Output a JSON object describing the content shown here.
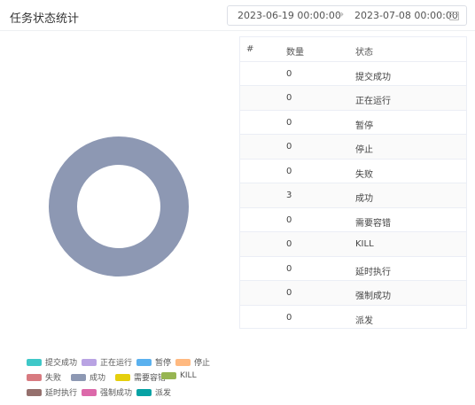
{
  "header": {
    "title": "任务状态统计",
    "date_start": "2023-06-19 00:00:00",
    "date_separator": "→",
    "date_end": "2023-07-08 00:00:00"
  },
  "table": {
    "columns": [
      "#",
      "数量",
      "状态"
    ],
    "rows": [
      {
        "count": "0",
        "status": "提交成功"
      },
      {
        "count": "0",
        "status": "正在运行"
      },
      {
        "count": "0",
        "status": "暂停"
      },
      {
        "count": "0",
        "status": "停止"
      },
      {
        "count": "0",
        "status": "失败"
      },
      {
        "count": "3",
        "status": "成功"
      },
      {
        "count": "0",
        "status": "需要容错"
      },
      {
        "count": "0",
        "status": "KILL"
      },
      {
        "count": "0",
        "status": "延时执行"
      },
      {
        "count": "0",
        "status": "强制成功"
      },
      {
        "count": "0",
        "status": "派发"
      }
    ]
  },
  "legend": [
    {
      "label": "提交成功",
      "color": "#3fc8c8"
    },
    {
      "label": "正在运行",
      "color": "#b9a3e3"
    },
    {
      "label": "暂停",
      "color": "#5ab1ef"
    },
    {
      "label": "停止",
      "color": "#ffb980"
    },
    {
      "label": "失败",
      "color": "#d87a80"
    },
    {
      "label": "成功",
      "color": "#8d98b3"
    },
    {
      "label": "需要容错",
      "color": "#e5cf0d"
    },
    {
      "label": "KILL",
      "color": "#97b552"
    },
    {
      "label": "延时执行",
      "color": "#95706d"
    },
    {
      "label": "强制成功",
      "color": "#dc69aa"
    },
    {
      "label": "派发",
      "color": "#07a2a4"
    }
  ],
  "chart_data": {
    "type": "pie",
    "style": "donut",
    "categories": [
      "提交成功",
      "正在运行",
      "暂停",
      "停止",
      "失败",
      "成功",
      "需要容错",
      "KILL",
      "延时执行",
      "强制成功",
      "派发"
    ],
    "values": [
      0,
      0,
      0,
      0,
      0,
      3,
      0,
      0,
      0,
      0,
      0
    ],
    "legend_position": "bottom-left"
  }
}
